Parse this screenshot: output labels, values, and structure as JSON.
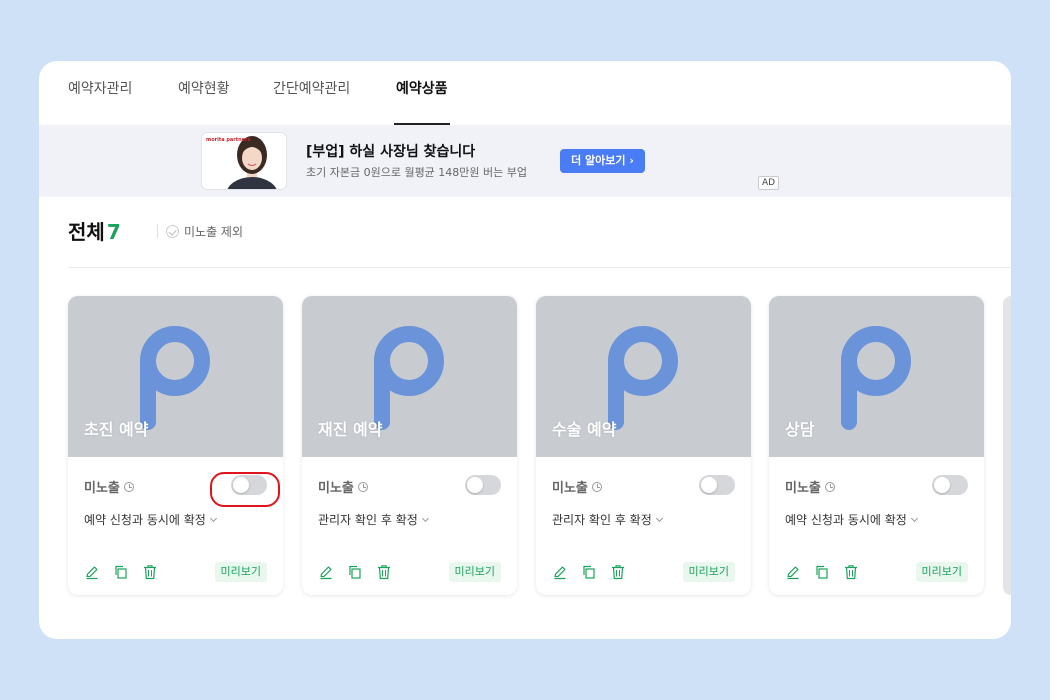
{
  "tabs": [
    {
      "label": "예약자관리",
      "active": false
    },
    {
      "label": "예약현황",
      "active": false
    },
    {
      "label": "간단예약관리",
      "active": false
    },
    {
      "label": "예약상품",
      "active": true
    }
  ],
  "ad": {
    "brand": "morita partners",
    "title": "[부업] 하실 사장님 찾습니다",
    "subtitle": "초기 자본금 0원으로 월평균 148만원 버는 부업",
    "button_label": "더 알아보기 ›",
    "tag": "AD",
    "button_color": "#4a7cf5"
  },
  "list": {
    "total_label": "전체",
    "total_count": "7",
    "filter_label": "미노출 제외"
  },
  "cards": [
    {
      "title": "초진 예약",
      "status": "미노출",
      "toggle_on": false,
      "confirm_mode": "예약 신청과 동시에 확정",
      "preview_label": "미리보기"
    },
    {
      "title": "재진 예약",
      "status": "미노출",
      "toggle_on": false,
      "confirm_mode": "관리자 확인 후 확정",
      "preview_label": "미리보기"
    },
    {
      "title": "수술 예약",
      "status": "미노출",
      "toggle_on": false,
      "confirm_mode": "관리자 확인 후 확정",
      "preview_label": "미리보기"
    },
    {
      "title": "상담",
      "status": "미노출",
      "toggle_on": false,
      "confirm_mode": "예약 신청과 동시에 확정",
      "preview_label": "미리보기"
    }
  ],
  "icons": {
    "placeholder": "p-logo-icon",
    "edit": "pencil-icon",
    "copy": "copy-icon",
    "delete": "trash-icon",
    "status": "clock-icon"
  },
  "colors": {
    "accent_green": "#1aa35b",
    "placeholder_bg": "#c8ccd1",
    "logo_blue": "#6b93d9",
    "highlight_red": "#e0141c"
  }
}
